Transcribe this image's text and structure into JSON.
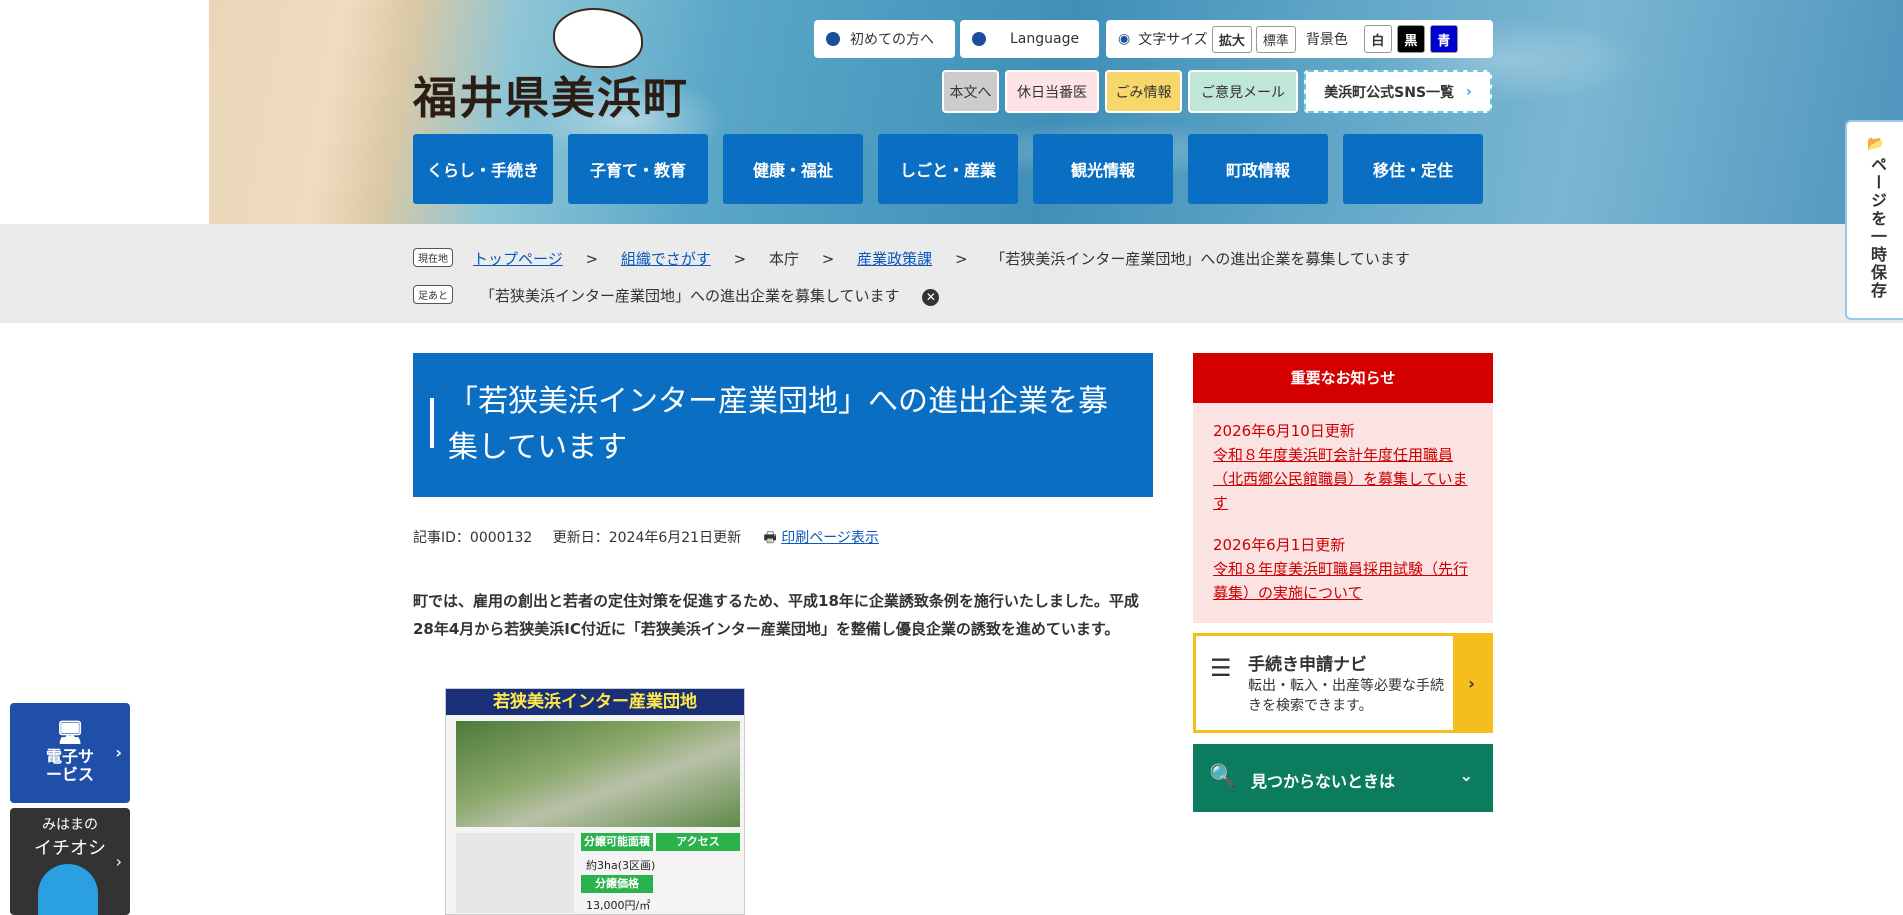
{
  "header": {
    "logo_text": "福井県美浜町",
    "first_visit": "初めての方へ",
    "language": "Language",
    "font_size_label": "文字サイズ",
    "font_size_large": "拡大",
    "font_size_normal": "標準",
    "bg_color_label": "背景色",
    "bg_white": "白",
    "bg_black": "黒",
    "bg_blue": "青",
    "skip_to_content": "本文へ",
    "holiday_doctor": "休日当番医",
    "garbage_info": "ごみ情報",
    "opinion_mail": "ご意見メール",
    "sns_list": "美浜町公式SNS一覧",
    "nav": [
      "くらし・手続き",
      "子育て・教育",
      "健康・福祉",
      "しごと・産業",
      "観光情報",
      "町政情報",
      "移住・定住"
    ]
  },
  "breadcrumb": {
    "current_label": "現在地",
    "items": [
      "トップページ",
      "組織でさがす",
      "本庁",
      "産業政策課",
      "「若狭美浜インター産業団地」への進出企業を募集しています"
    ],
    "separator": ">",
    "footprint_label": "足あと",
    "footprint_item": "「若狭美浜インター産業団地」への進出企業を募集しています"
  },
  "article": {
    "title": "「若狭美浜インター産業団地」への進出企業を募集しています",
    "id_text": "記事ID：0000132",
    "updated_text": "更新日：2024年6月21日更新",
    "print_link": "印刷ページ表示",
    "body": "町では、雇用の創出と若者の定住対策を促進するため、平成18年に企業誘致条例を施行いたしました。平成28年4月から若狭美浜IC付近に「若狭美浜インター産業団地」を整備し優良企業の誘致を進めています。",
    "image": {
      "title": "若狭美浜インター産業団地",
      "area_label": "分譲可能面積",
      "area_value": "約3ha(3区画)",
      "price_label": "分譲価格",
      "price_value": "13,000円/㎡",
      "access_label": "アクセス"
    }
  },
  "sidebar": {
    "notice_title": "重要なお知らせ",
    "notices": [
      {
        "date": "2026年6月10日更新",
        "text": "令和８年度美浜町会計年度任用職員（北西郷公民館職員）を募集しています"
      },
      {
        "date": "2026年6月1日更新",
        "text": "令和８年度美浜町職員採用試験（先行募集）の実施について"
      }
    ],
    "navi_title": "手続き申請ナビ",
    "navi_desc": "転出・転入・出産等必要な手続きを検索できます。",
    "not_found": "見つからないときは"
  },
  "floating": {
    "save_page": "ページを一時保存",
    "eservice": "電子サービス",
    "ichioshi_small": "みはまの",
    "ichioshi_big": "イチオシ"
  }
}
